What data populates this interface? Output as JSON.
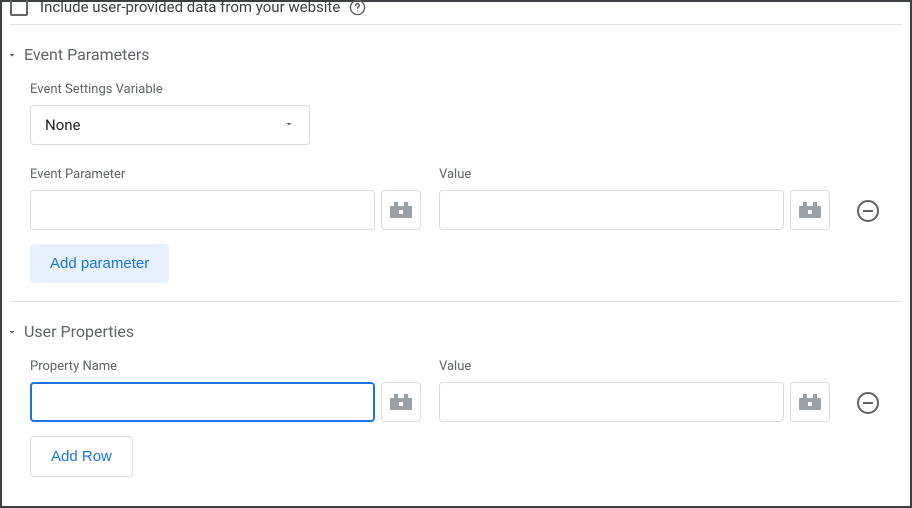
{
  "topCheckbox": {
    "label": "Include user-provided data from your website",
    "checked": false
  },
  "eventParams": {
    "title": "Event Parameters",
    "settingsLabel": "Event Settings Variable",
    "settingsValue": "None",
    "paramLabel": "Event Parameter",
    "valueLabel": "Value",
    "paramInput": "",
    "valueInput": "",
    "addButton": "Add parameter"
  },
  "userProps": {
    "title": "User Properties",
    "nameLabel": "Property Name",
    "valueLabel": "Value",
    "nameInput": "",
    "valueInput": "",
    "addButton": "Add Row"
  }
}
